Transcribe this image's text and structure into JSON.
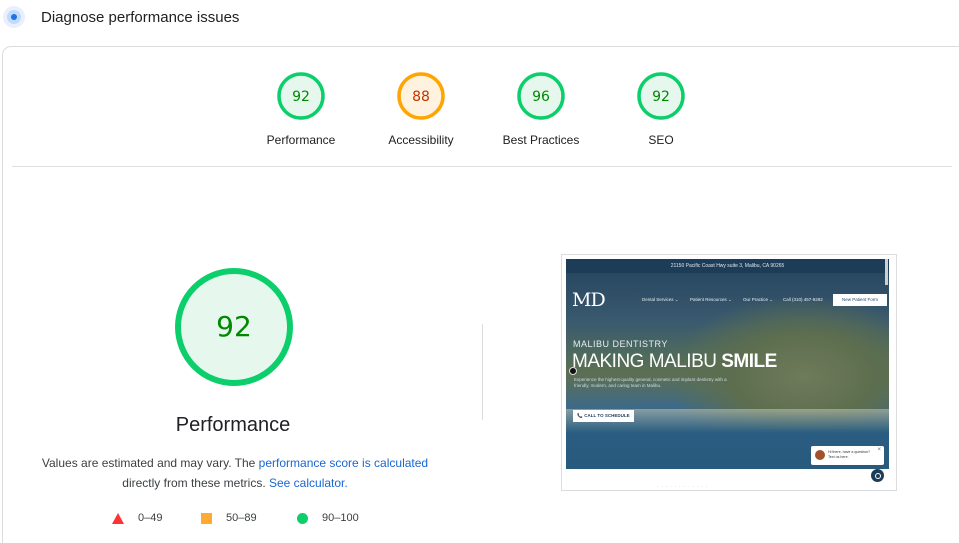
{
  "header": {
    "title": "Diagnose performance issues",
    "icon": "lighthouse-icon"
  },
  "category_gauges": [
    {
      "label": "Performance",
      "score": "92",
      "color": "#0cce6b",
      "fill": "#e6f8ee",
      "text_color": "#008800"
    },
    {
      "label": "Accessibility",
      "score": "88",
      "color": "#ffa400",
      "fill": "#fff3e0",
      "text_color": "#c33300"
    },
    {
      "label": "Best Practices",
      "score": "96",
      "color": "#0cce6b",
      "fill": "#e6f8ee",
      "text_color": "#008800"
    },
    {
      "label": "SEO",
      "score": "92",
      "color": "#0cce6b",
      "fill": "#e6f8ee",
      "text_color": "#008800"
    }
  ],
  "main": {
    "score": "92",
    "title": "Performance",
    "desc_prefix": "Values are estimated and may vary. The ",
    "desc_link1": "performance score is calculated",
    "desc_mid": "directly from these metrics.",
    "desc_link2": "See calculator.",
    "color": "#0cce6b"
  },
  "legend": [
    {
      "shape": "triangle",
      "range": "0–49",
      "color": "#ff3333"
    },
    {
      "shape": "square",
      "range": "50–89",
      "color": "#ffaa33"
    },
    {
      "shape": "circle",
      "range": "90–100",
      "color": "#0cce6b"
    }
  ],
  "screenshot": {
    "topbar": "21150 Pacific Coast Hwy suite 3, Malibu, CA 90265",
    "logo": "MD",
    "nav": [
      "Dental Services ⌄",
      "Patient Resources ⌄",
      "Our Practice ⌄",
      "Call (310) 457-9292"
    ],
    "button": "New Patient Form",
    "kicker": "MALIBU DENTISTRY",
    "headline_light": "MAKING MALIBU ",
    "headline_bold": "SMILE",
    "sub": "Experience the highest-quality general, cosmetic and implant dentistry with a friendly, modern, and caring team in Malibu.",
    "cta": "📞 CALL TO SCHEDULE",
    "chat_line1": "Hi there, have a question?",
    "chat_line2": "Text us here.",
    "below": "· · · · · · · · · · · ·"
  }
}
